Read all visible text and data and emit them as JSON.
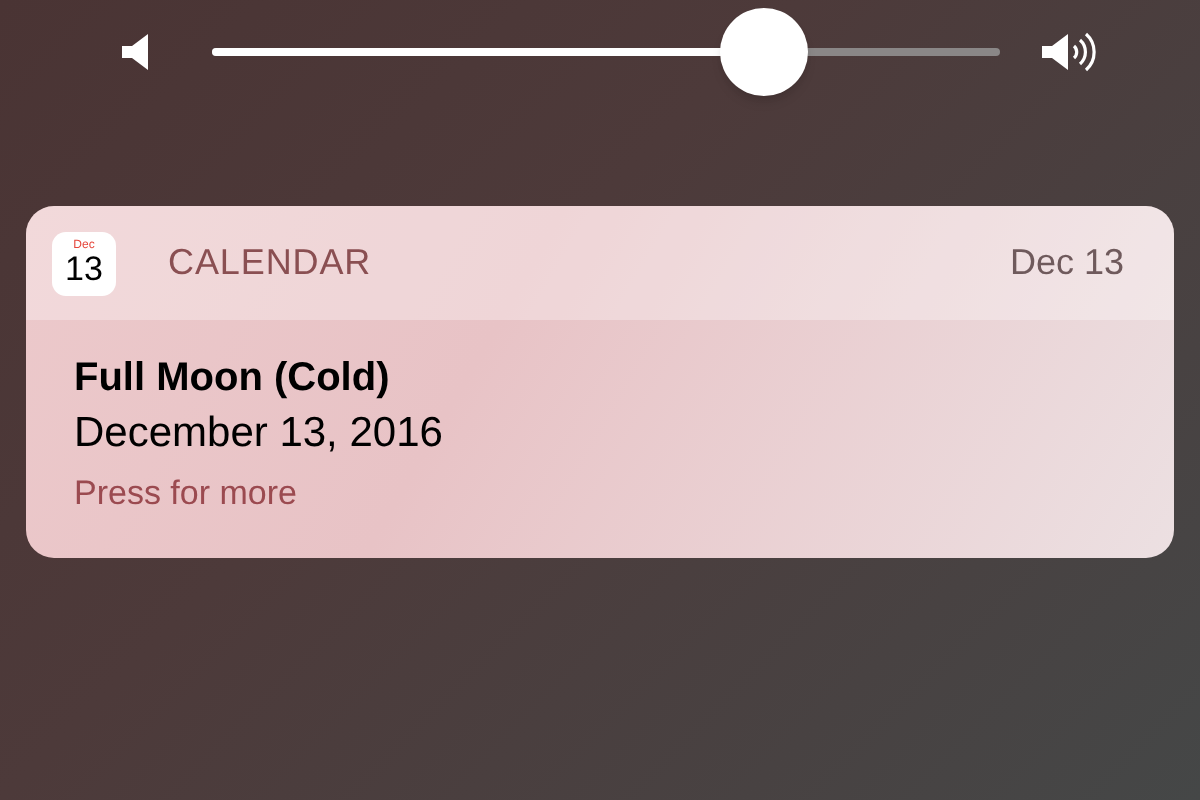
{
  "volume": {
    "level": 0.7
  },
  "notification": {
    "app_icon": {
      "month": "Dec",
      "day": "13"
    },
    "app": "CALENDAR",
    "time": "Dec 13",
    "title": "Full Moon (Cold)",
    "body": "December 13, 2016",
    "action": "Press for more"
  }
}
